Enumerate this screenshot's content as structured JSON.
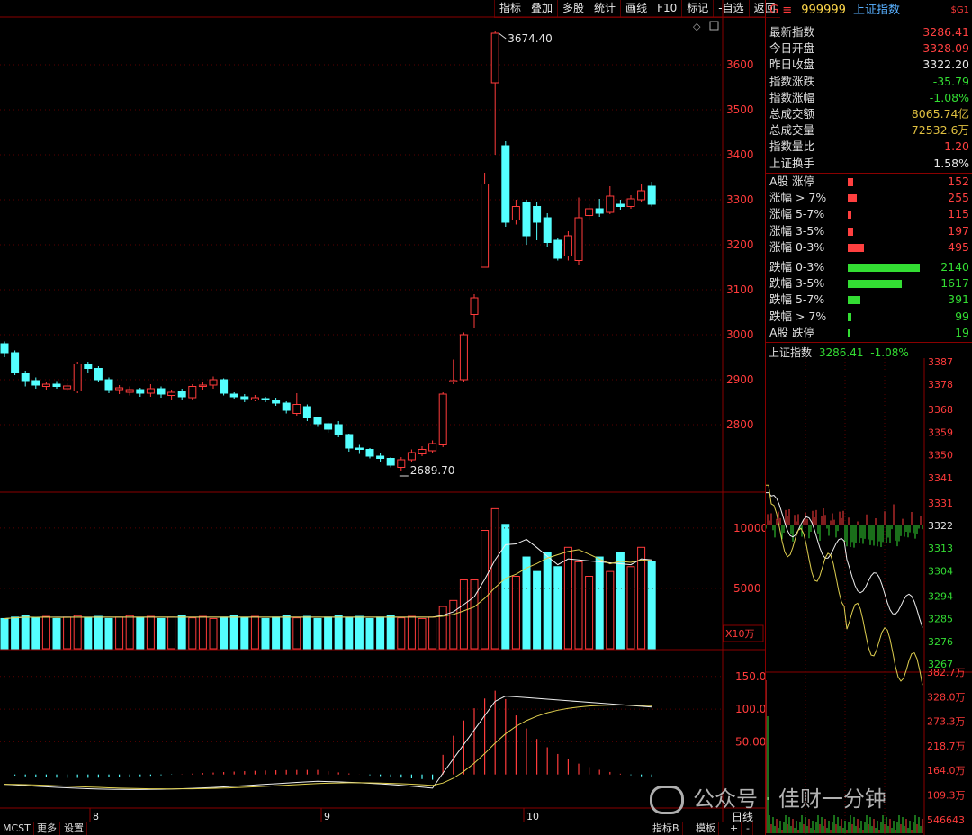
{
  "toolbar": {
    "items": [
      "指标",
      "叠加",
      "多股",
      "统计",
      "画线",
      "F10",
      "标记",
      "-自选",
      "返回"
    ]
  },
  "header": {
    "code_prefix": "G ≡",
    "code": "999999",
    "name": "上证指数",
    "right_tag": "$G1"
  },
  "quote": [
    {
      "label": "最新指数",
      "value": "3286.41",
      "color": "#ff4040"
    },
    {
      "label": "今日开盘",
      "value": "3328.09",
      "color": "#ff4040"
    },
    {
      "label": "昨日收盘",
      "value": "3322.20",
      "color": "#e6e6e6"
    },
    {
      "label": "指数涨跌",
      "value": "-35.79",
      "color": "#33dd33"
    },
    {
      "label": "指数涨幅",
      "value": "-1.08%",
      "color": "#33dd33"
    },
    {
      "label": "总成交额",
      "value": "8065.74亿",
      "color": "#e0c040"
    },
    {
      "label": "总成交量",
      "value": "72532.6万",
      "color": "#e0c040"
    },
    {
      "label": "指数量比",
      "value": "1.20",
      "color": "#ff4040"
    },
    {
      "label": "上证换手",
      "value": "1.58%",
      "color": "#e6e6e6"
    }
  ],
  "breadth_up": [
    {
      "label": "A股 涨停",
      "count": "152",
      "w": 0.08
    },
    {
      "label": "涨幅 > 7%",
      "count": "255",
      "w": 0.12
    },
    {
      "label": "涨幅 5-7%",
      "count": "115",
      "w": 0.05
    },
    {
      "label": "涨幅 3-5%",
      "count": "197",
      "w": 0.08
    },
    {
      "label": "涨幅 0-3%",
      "count": "495",
      "w": 0.23
    }
  ],
  "breadth_down": [
    {
      "label": "跌幅 0-3%",
      "count": "2140",
      "w": 1.0
    },
    {
      "label": "跌幅 3-5%",
      "count": "1617",
      "w": 0.75
    },
    {
      "label": "跌幅 5-7%",
      "count": "391",
      "w": 0.18
    },
    {
      "label": "跌幅 > 7%",
      "count": "99",
      "w": 0.05
    },
    {
      "label": "A股 跌停",
      "count": "19",
      "w": 0.01
    }
  ],
  "intraday": {
    "title": "上证指数",
    "price": "3286.41",
    "change": "-1.08%",
    "price_ticks": [
      "3387",
      "3378",
      "3368",
      "3359",
      "3350",
      "3341",
      "3331",
      "3322",
      "3313",
      "3304",
      "3294",
      "3285",
      "3276",
      "3267"
    ],
    "vol_ticks": [
      "382.7万",
      "328.0万",
      "273.3万",
      "218.7万",
      "164.0万",
      "109.3万",
      "546643"
    ]
  },
  "main_axis": {
    "ticks": [
      "3600",
      "3500",
      "3400",
      "3300",
      "3200",
      "3100",
      "3000",
      "2900",
      "2800"
    ],
    "high_label": "3674.40",
    "low_label": "2689.70"
  },
  "vol_axis": {
    "ticks": [
      "10000",
      "5000"
    ],
    "unit": "X10万"
  },
  "ind_axis": {
    "ticks": [
      "150.0",
      "100.0",
      "50.00"
    ]
  },
  "x_labels": [
    "8",
    "9",
    "10"
  ],
  "period": "日线",
  "bottom_tabs": [
    "MCST",
    "更多",
    "设置"
  ],
  "bottom_right": [
    "指标B",
    "模板"
  ],
  "watermark": "公众号 · 佳财一分钟",
  "colors": {
    "up": "#ff3b3b",
    "down": "#54ffff",
    "grid": "#8a0000"
  },
  "chart_data": {
    "type": "candlestick",
    "ylim": [
      2650,
      3700
    ],
    "candles": [
      [
        2980,
        2960,
        2985,
        2950
      ],
      [
        2960,
        2915,
        2965,
        2910
      ],
      [
        2915,
        2898,
        2920,
        2885
      ],
      [
        2898,
        2888,
        2905,
        2880
      ],
      [
        2885,
        2890,
        2895,
        2878
      ],
      [
        2890,
        2885,
        2897,
        2880
      ],
      [
        2880,
        2886,
        2892,
        2875
      ],
      [
        2875,
        2935,
        2940,
        2870
      ],
      [
        2935,
        2925,
        2940,
        2915
      ],
      [
        2925,
        2900,
        2930,
        2895
      ],
      [
        2900,
        2878,
        2905,
        2870
      ],
      [
        2878,
        2882,
        2888,
        2868
      ],
      [
        2872,
        2878,
        2885,
        2865
      ],
      [
        2878,
        2870,
        2882,
        2862
      ],
      [
        2870,
        2880,
        2890,
        2862
      ],
      [
        2880,
        2868,
        2885,
        2860
      ],
      [
        2865,
        2872,
        2878,
        2855
      ],
      [
        2875,
        2862,
        2880,
        2855
      ],
      [
        2860,
        2885,
        2890,
        2855
      ],
      [
        2885,
        2888,
        2895,
        2878
      ],
      [
        2888,
        2900,
        2907,
        2880
      ],
      [
        2900,
        2870,
        2903,
        2865
      ],
      [
        2868,
        2862,
        2872,
        2858
      ],
      [
        2862,
        2858,
        2868,
        2850
      ],
      [
        2855,
        2860,
        2866,
        2852
      ],
      [
        2858,
        2855,
        2862,
        2850
      ],
      [
        2855,
        2848,
        2860,
        2842
      ],
      [
        2848,
        2832,
        2852,
        2825
      ],
      [
        2825,
        2845,
        2870,
        2820
      ],
      [
        2840,
        2815,
        2845,
        2808
      ],
      [
        2815,
        2802,
        2818,
        2795
      ],
      [
        2802,
        2790,
        2805,
        2782
      ],
      [
        2800,
        2778,
        2808,
        2772
      ],
      [
        2778,
        2748,
        2780,
        2740
      ],
      [
        2748,
        2745,
        2755,
        2735
      ],
      [
        2745,
        2730,
        2748,
        2725
      ],
      [
        2730,
        2725,
        2738,
        2718
      ],
      [
        2725,
        2710,
        2728,
        2705
      ],
      [
        2705,
        2722,
        2728,
        2698
      ],
      [
        2722,
        2738,
        2745,
        2718
      ],
      [
        2735,
        2745,
        2752,
        2730
      ],
      [
        2742,
        2758,
        2765,
        2738
      ],
      [
        2755,
        2868,
        2872,
        2750
      ],
      [
        2895,
        2898,
        2945,
        2890
      ],
      [
        2900,
        3000,
        3005,
        2895
      ],
      [
        3045,
        3082,
        3090,
        3015
      ],
      [
        3150,
        3335,
        3360,
        3150
      ],
      [
        3560,
        3670,
        3674,
        3400
      ],
      [
        3420,
        3250,
        3430,
        3240
      ],
      [
        3255,
        3285,
        3300,
        3245
      ],
      [
        3295,
        3220,
        3300,
        3200
      ],
      [
        3285,
        3250,
        3295,
        3210
      ],
      [
        3260,
        3205,
        3270,
        3195
      ],
      [
        3210,
        3170,
        3215,
        3165
      ],
      [
        3175,
        3220,
        3230,
        3165
      ],
      [
        3165,
        3260,
        3305,
        3155
      ],
      [
        3265,
        3280,
        3290,
        3255
      ],
      [
        3280,
        3270,
        3302,
        3262
      ],
      [
        3272,
        3308,
        3330,
        3268
      ],
      [
        3290,
        3285,
        3300,
        3278
      ],
      [
        3285,
        3302,
        3310,
        3280
      ],
      [
        3300,
        3320,
        3335,
        3295
      ],
      [
        3330,
        3290,
        3340,
        3285
      ]
    ]
  }
}
